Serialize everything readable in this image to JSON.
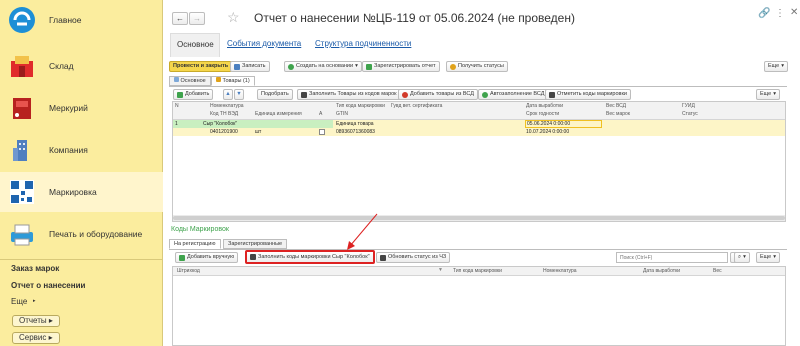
{
  "sidebar": {
    "items": [
      {
        "label": "Главное",
        "icon": "main-logo-icon"
      },
      {
        "label": "Склад",
        "icon": "warehouse-icon"
      },
      {
        "label": "Меркурий",
        "icon": "mercury-icon"
      },
      {
        "label": "Компания",
        "icon": "company-icon"
      },
      {
        "label": "Маркировка",
        "icon": "qr-code-icon"
      },
      {
        "label": "Печать и оборудование",
        "icon": "printer-icon"
      }
    ],
    "links": [
      "Заказ марок",
      "Отчет о нанесении",
      "Еще"
    ],
    "pills": [
      "Отчеты",
      "Сервис"
    ]
  },
  "header": {
    "title": "Отчет о нанесении №ЦБ-119 от 05.06.2024 (не проведен)"
  },
  "doc_tabs": [
    "Основное",
    "События документа",
    "Структура подчиненности"
  ],
  "toolbar": {
    "post_close": "Провести и закрыть",
    "save": "Записать",
    "create_based": "Создать на основании",
    "register": "Зарегистрировать отчет",
    "get_status": "Получить статусы",
    "more": "Еще"
  },
  "inner_tabs": [
    "Основное",
    "Товары (1)"
  ],
  "goods_toolbar": {
    "add": "Добавить",
    "select": "Подобрать",
    "fill_codes": "Заполнить Товары из кодов марок",
    "add_vsd": "Добавить товары из ВСД",
    "autofill": "Автозаполнение ВСД",
    "show_codes": "Отметить коды маркировки",
    "more": "Еще"
  },
  "goods_headers": {
    "row1": [
      "N",
      "Номенклатура",
      "Тип кода маркировки",
      "Гувд вет. сертификата",
      "Дата выработки",
      "Вес ВСД",
      "ГУИД"
    ],
    "row2": [
      "Код ТН ВЭД",
      "Единица измерения",
      "A",
      "GTIN",
      "Срок годности",
      "Вес марок",
      "Статус"
    ]
  },
  "goods_row": {
    "n": "1",
    "name": "Сыр \"Колобок\"",
    "type": "Единица товара",
    "prod_date": "05.06.2024 0:00:00",
    "tnved": "0401201900",
    "unit": "шт",
    "gtin": "08936071360083",
    "expiry": "10.07.2024 0:00:00"
  },
  "codes": {
    "title": "Коды Маркировок",
    "tabs": [
      "На регистрацию",
      "Зарегистрированные"
    ],
    "add_manual": "Добавить вручную",
    "fill_btn": "Заполнить коды маркировки Сыр \"Колобок\"",
    "refresh": "Обновить статус из ЧЗ",
    "search_placeholder": "Поиск (Ctrl+F)",
    "more": "Еще",
    "headers": [
      "Штрихкод",
      "Тип кода маркировки",
      "Номенклатура",
      "Дата выработки",
      "Вес"
    ]
  }
}
